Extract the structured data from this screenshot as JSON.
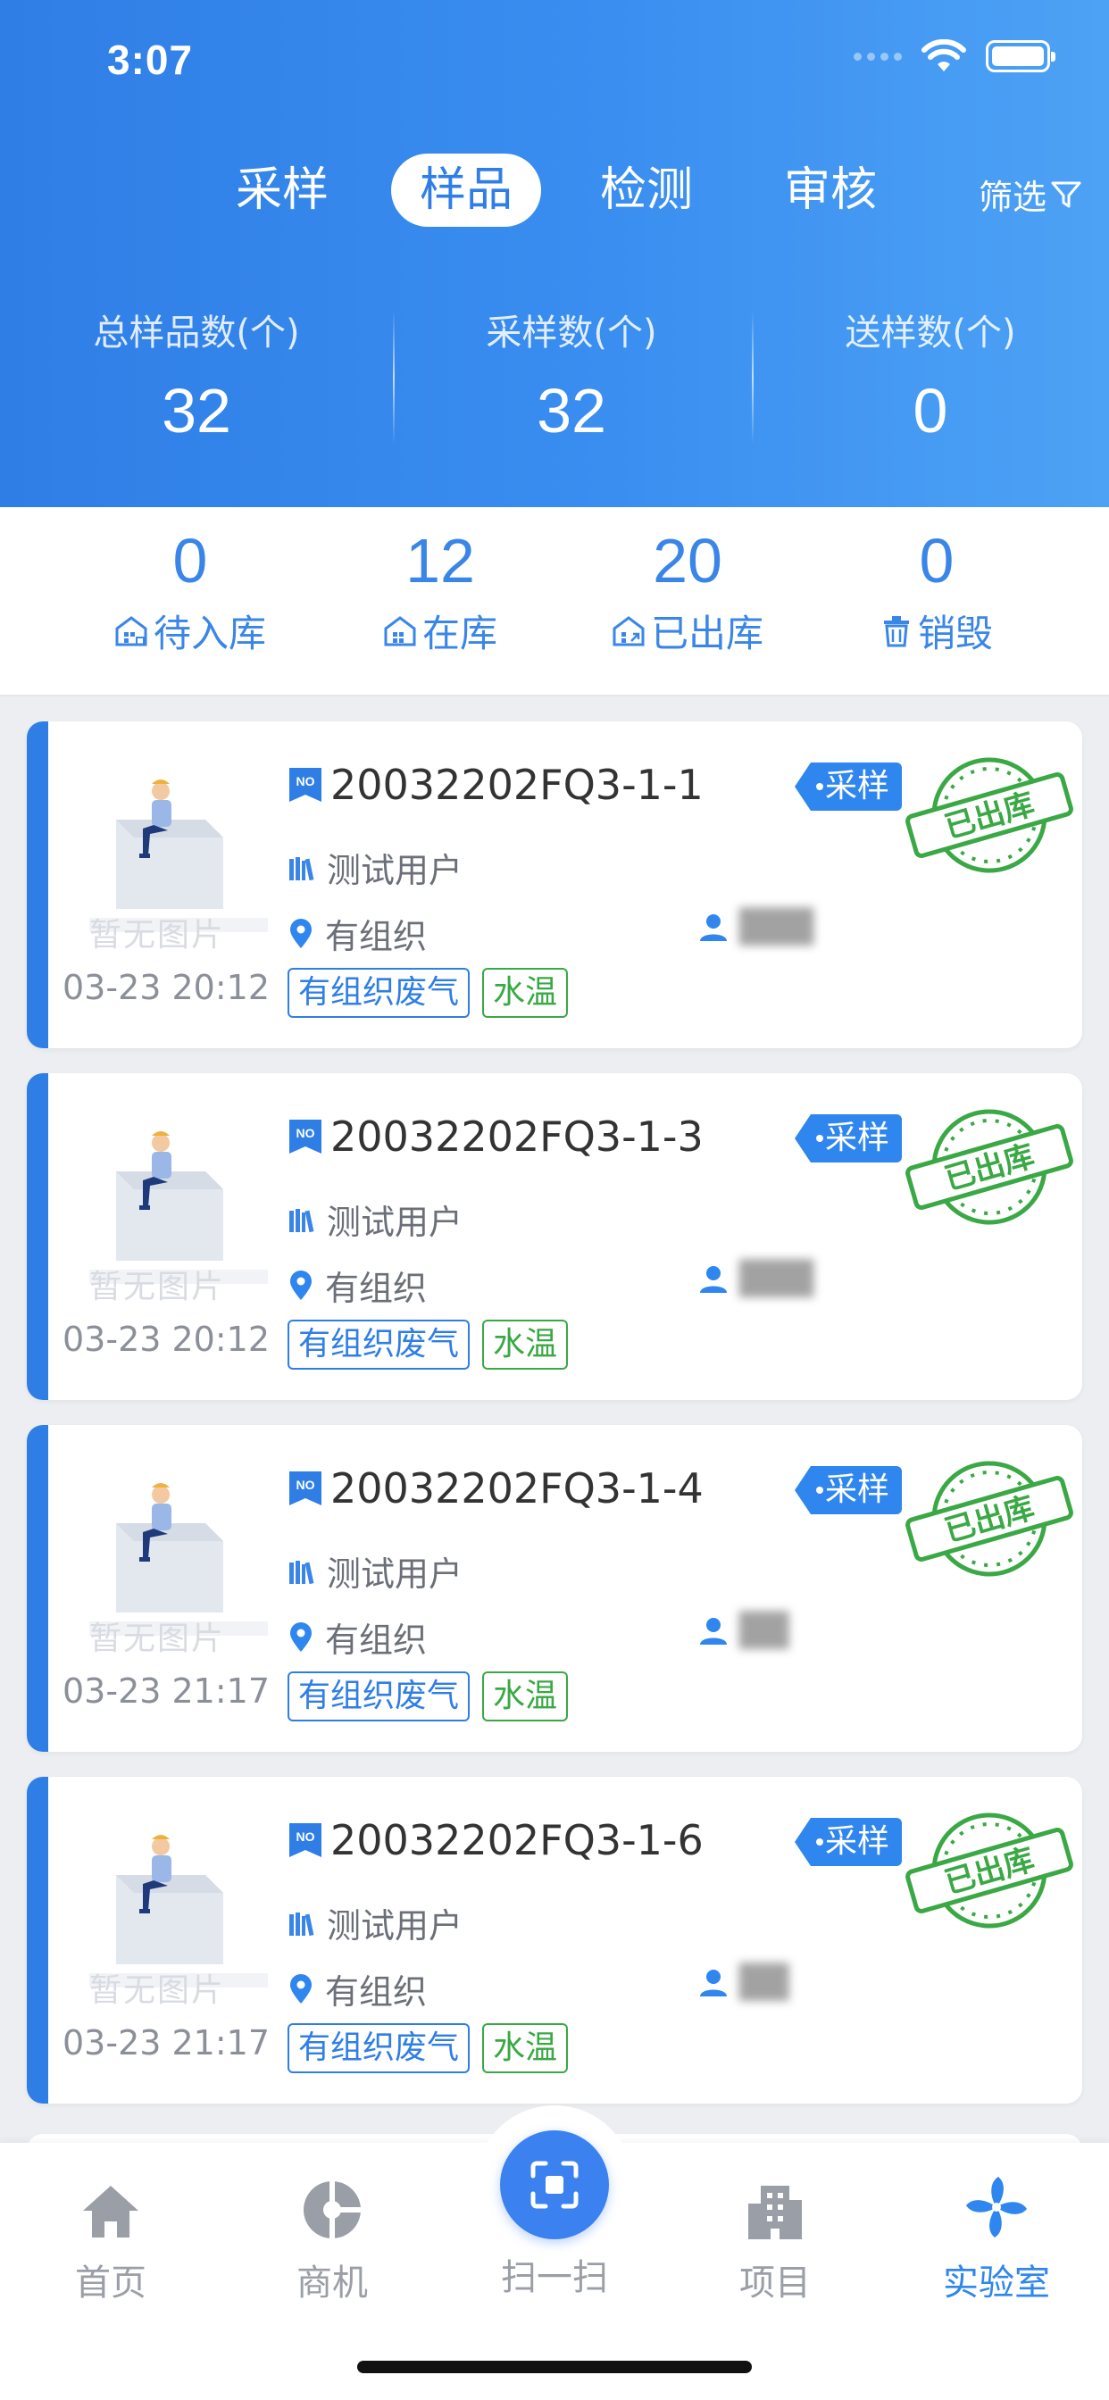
{
  "status_bar": {
    "time": "3:07"
  },
  "tabs": [
    {
      "label": "采样",
      "active": false
    },
    {
      "label": "样品",
      "active": true
    },
    {
      "label": "检测",
      "active": false
    },
    {
      "label": "审核",
      "active": false
    }
  ],
  "filter_label": "筛选",
  "stats": [
    {
      "label": "总样品数(个)",
      "value": "32"
    },
    {
      "label": "采样数(个)",
      "value": "32"
    },
    {
      "label": "送样数(个)",
      "value": "0"
    }
  ],
  "storage": [
    {
      "count": "0",
      "label": "待入库",
      "icon": "warehouse-in-icon"
    },
    {
      "count": "12",
      "label": "在库",
      "icon": "warehouse-icon"
    },
    {
      "count": "20",
      "label": "已出库",
      "icon": "warehouse-out-icon"
    },
    {
      "count": "0",
      "label": "销毁",
      "icon": "trash-icon"
    }
  ],
  "samples": [
    {
      "code": "20032202FQ3-1-1",
      "user": "测试用户",
      "location": "有组织",
      "date": "03-23 20:12",
      "type": "采样",
      "stamp": "已出库",
      "placeholder": "暂无图片",
      "tags": [
        "有组织废气",
        "水温"
      ]
    },
    {
      "code": "20032202FQ3-1-3",
      "user": "测试用户",
      "location": "有组织",
      "date": "03-23 20:12",
      "type": "采样",
      "stamp": "已出库",
      "placeholder": "暂无图片",
      "tags": [
        "有组织废气",
        "水温"
      ]
    },
    {
      "code": "20032202FQ3-1-4",
      "user": "测试用户",
      "location": "有组织",
      "date": "03-23 21:17",
      "type": "采样",
      "stamp": "已出库",
      "placeholder": "暂无图片",
      "tags": [
        "有组织废气",
        "水温"
      ]
    },
    {
      "code": "20032202FQ3-1-6",
      "user": "测试用户",
      "location": "有组织",
      "date": "03-23 21:17",
      "type": "采样",
      "stamp": "已出库",
      "placeholder": "暂无图片",
      "tags": [
        "有组织废气",
        "水温"
      ]
    }
  ],
  "nav": [
    {
      "label": "首页",
      "icon": "home-icon",
      "active": false
    },
    {
      "label": "商机",
      "icon": "opportunity-icon",
      "active": false
    },
    {
      "label": "扫一扫",
      "icon": "scan-icon",
      "active": false
    },
    {
      "label": "项目",
      "icon": "building-icon",
      "active": false
    },
    {
      "label": "实验室",
      "icon": "fan-icon",
      "active": true
    }
  ],
  "colors": {
    "primary": "#2f7ee6",
    "accent_blue": "#3a86e8",
    "stamp_green": "#3aa844"
  }
}
